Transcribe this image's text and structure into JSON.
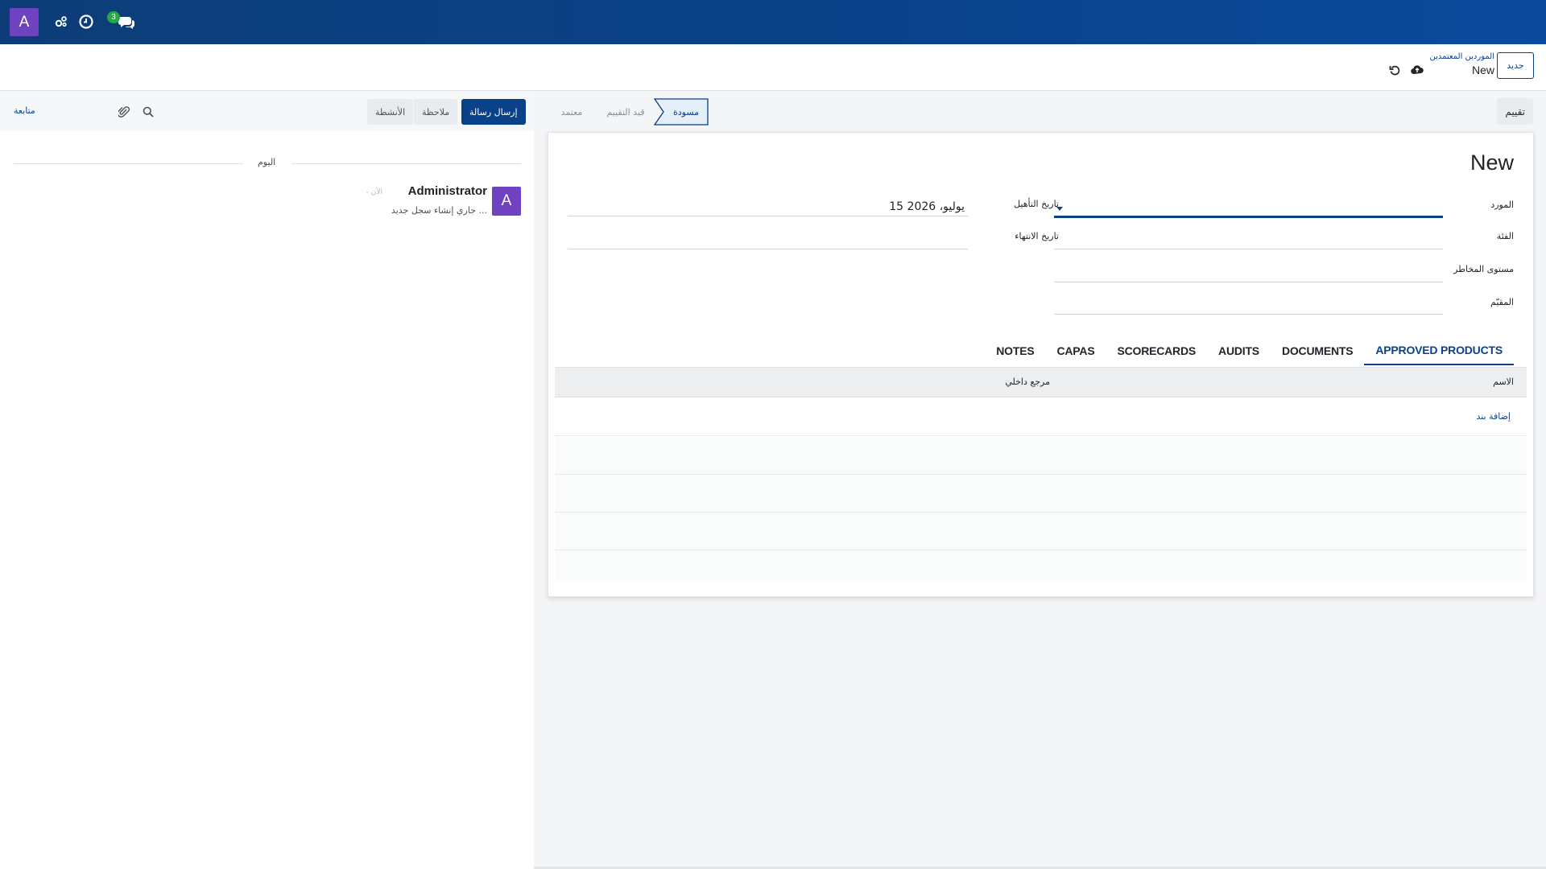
{
  "navbar": {
    "user_initial": "A",
    "discuss_badge": "3",
    "icons": [
      "settings-cogs-icon",
      "clock-icon",
      "chat-icon"
    ],
    "accent_color": "#0a4289",
    "avatar_color": "#6f42c1"
  },
  "control_panel": {
    "new_button": "جديد",
    "breadcrumb_parent": "الموردين المعتمدين",
    "breadcrumb_current": "New",
    "icons": [
      "save-cloud-icon",
      "discard-undo-icon"
    ]
  },
  "statusbar": {
    "evaluate_button": "تقييم",
    "stages": {
      "draft": "مسودة",
      "under_evaluation": "قيد التقييم",
      "approved": "معتمد"
    },
    "active_stage": "draft"
  },
  "form": {
    "title": "New",
    "fields": {
      "supplier_label": "المورد",
      "supplier_value": "",
      "category_label": "الفئة",
      "category_value": "",
      "risk_level_label": "مستوى المخاطر",
      "risk_level_value": "",
      "evaluator_label": "المقيّم",
      "evaluator_value": "",
      "qualification_date_label": "تاريخ التأهيل",
      "qualification_date_value": "15 يوليو، 2026",
      "expiry_date_label": "تاريخ الانتهاء",
      "expiry_date_value": ""
    },
    "tabs": [
      "APPROVED PRODUCTS",
      "DOCUMENTS",
      "AUDITS",
      "SCORECARDS",
      "CAPAS",
      "NOTES"
    ],
    "active_tab": "APPROVED PRODUCTS",
    "table": {
      "columns": [
        "الاسم",
        "مرجع داخلي"
      ],
      "add_line": "إضافة بند"
    }
  },
  "chatter": {
    "send_message": "إرسال رسالة",
    "log_note": "ملاحظة",
    "activities": "الأنشطة",
    "follow": "متابعة",
    "icons": [
      "search-icon",
      "paperclip-icon"
    ],
    "date_separator": "اليوم",
    "message": {
      "author_initial": "A",
      "author": "Administrator",
      "time": "- الآن",
      "body": "جاري إنشاء سجل جديد ..."
    }
  }
}
